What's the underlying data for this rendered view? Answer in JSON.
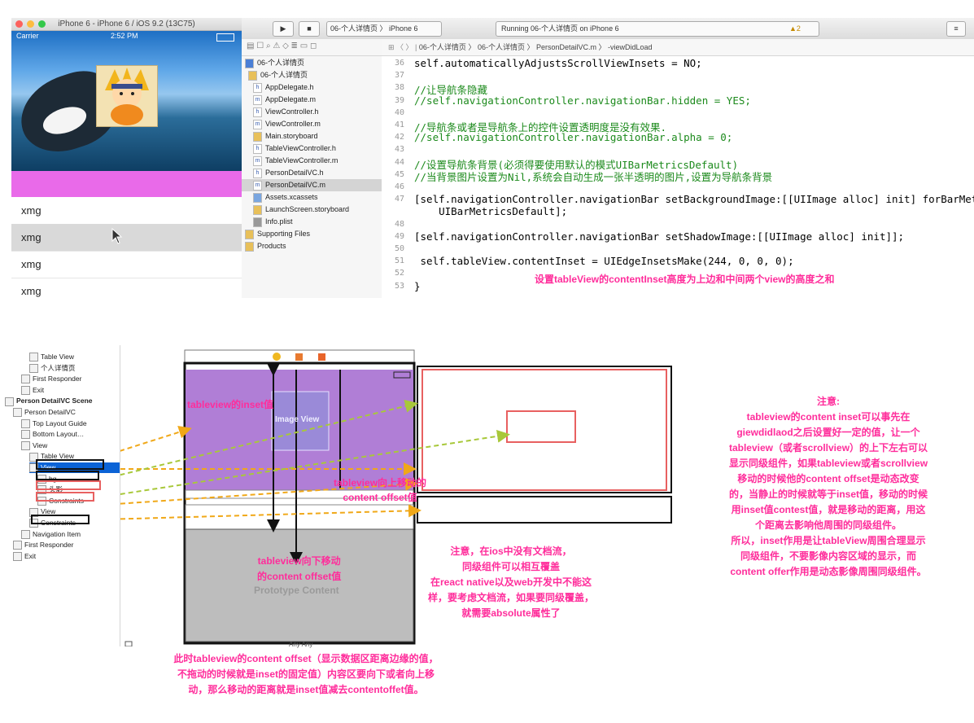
{
  "simulator": {
    "title": "iPhone 6 - iPhone 6 / iOS 9.2 (13C75)",
    "carrier": "Carrier",
    "time": "2:52 PM",
    "rows": [
      "xmg",
      "xmg",
      "xmg",
      "xmg"
    ],
    "pink_color": "#e96ae9"
  },
  "xcode": {
    "toolbar": {
      "scheme": "06-个人详情页",
      "device": "iPhone 6",
      "status": "Running 06-个人详情页 on iPhone 6",
      "warning_count": "2"
    },
    "jump_bar": [
      "06-个人详情页",
      "06-个人详情页",
      "PersonDetailVC.m",
      "-viewDidLoad"
    ],
    "files": [
      {
        "name": "06-个人详情页",
        "kind": "project"
      },
      {
        "name": "06-个人详情页",
        "kind": "folder"
      },
      {
        "name": "AppDelegate.h",
        "kind": "h"
      },
      {
        "name": "AppDelegate.m",
        "kind": "m"
      },
      {
        "name": "ViewController.h",
        "kind": "h"
      },
      {
        "name": "ViewController.m",
        "kind": "m"
      },
      {
        "name": "Main.storyboard",
        "kind": "sb"
      },
      {
        "name": "TableViewController.h",
        "kind": "h"
      },
      {
        "name": "TableViewController.m",
        "kind": "m"
      },
      {
        "name": "PersonDetailVC.h",
        "kind": "h"
      },
      {
        "name": "PersonDetailVC.m",
        "kind": "m",
        "selected": true
      },
      {
        "name": "Assets.xcassets",
        "kind": "asset"
      },
      {
        "name": "LaunchScreen.storyboard",
        "kind": "sb"
      },
      {
        "name": "Info.plist",
        "kind": "plist"
      },
      {
        "name": "Supporting Files",
        "kind": "folder"
      },
      {
        "name": "Products",
        "kind": "folder"
      }
    ],
    "code_lines": [
      {
        "n": "36",
        "text": "self.automaticallyAdjustsScrollViewInsets = NO;"
      },
      {
        "n": "37",
        "text": ""
      },
      {
        "n": "38",
        "text": "//让导航条隐藏"
      },
      {
        "n": "39",
        "text": "//self.navigationController.navigationBar.hidden = YES;"
      },
      {
        "n": "40",
        "text": ""
      },
      {
        "n": "41",
        "text": "//导航条或者是导航条上的控件设置透明度是没有效果."
      },
      {
        "n": "42",
        "text": "//self.navigationController.navigationBar.alpha = 0;"
      },
      {
        "n": "43",
        "text": ""
      },
      {
        "n": "44",
        "text": "//设置导航条背景(必须得要使用默认的模式UIBarMetricsDefault)"
      },
      {
        "n": "45",
        "text": "//当背景图片设置为Nil,系统会自动生成一张半透明的图片,设置为导航条背景"
      },
      {
        "n": "46",
        "text": ""
      },
      {
        "n": "47",
        "text": "[self.navigationController.navigationBar setBackgroundImage:[[UIImage alloc] init] forBarMetrics:"
      },
      {
        "n": "",
        "text": "    UIBarMetricsDefault];"
      },
      {
        "n": "48",
        "text": ""
      },
      {
        "n": "49",
        "text": "[self.navigationController.navigationBar setShadowImage:[[UIImage alloc] init]];"
      },
      {
        "n": "50",
        "text": ""
      },
      {
        "n": "51",
        "text": " self.tableView.contentInset = UIEdgeInsetsMake(244, 0, 0, 0);"
      },
      {
        "n": "52",
        "text": ""
      },
      {
        "n": "53",
        "text": "}"
      }
    ],
    "annotation": "设置tableView的contentInset高度为上边和中间两个view的高度之和"
  },
  "outline": {
    "items": [
      {
        "label": "Table View",
        "indent": 3
      },
      {
        "label": "个人详情页",
        "indent": 3
      },
      {
        "label": "First Responder",
        "indent": 2
      },
      {
        "label": "Exit",
        "indent": 2
      },
      {
        "label": "Person DetailVC Scene",
        "indent": 0,
        "bold": true
      },
      {
        "label": "Person DetailVC",
        "indent": 1
      },
      {
        "label": "Top Layout Guide",
        "indent": 2
      },
      {
        "label": "Bottom Layout…",
        "indent": 2
      },
      {
        "label": "View",
        "indent": 2
      },
      {
        "label": "Table View",
        "indent": 3
      },
      {
        "label": "View",
        "indent": 3,
        "selected": true
      },
      {
        "label": "bg",
        "indent": 4
      },
      {
        "label": "头影",
        "indent": 4
      },
      {
        "label": "Constraints",
        "indent": 4
      },
      {
        "label": "View",
        "indent": 3
      },
      {
        "label": "Constraints",
        "indent": 3
      },
      {
        "label": "Navigation Item",
        "indent": 2
      },
      {
        "label": "First Responder",
        "indent": 1
      },
      {
        "label": "Exit",
        "indent": 1
      }
    ]
  },
  "canvas": {
    "image_view_label": "Image View",
    "prototype_label": "Prototype Content",
    "size_label": "Any  Any",
    "labels": {
      "inset": "tableview的inset值",
      "move_up": "tableview向上移动的\ncontent offset值",
      "move_down": "tableview向下移动\n的content offset值"
    },
    "note_right_title": "注意:",
    "note_right": [
      "tableview的content inset可以事先在",
      "giewdidlaod之后设置好一定的值，让一个",
      "tableview（或者scrollview）的上下左右可以",
      "显示同级组件，如果tableview或者scrollview",
      "移动的时候他的content offset是动态改变",
      "的，当静止的时候就等于inset值，移动的时候",
      "用inset值contest值，就是移动的距离，用这",
      "个距离去影响他周围的同级组件。",
      "所以，inset作用是让tableView周围合理显示",
      "同级组件，不要影像内容区域的显示，而",
      "content offer作用是动态影像周围同级组件。"
    ],
    "note_mid": [
      "注意，在ios中没有文档流，",
      "同级组件可以相互覆盖",
      "在react native以及web开发中不能这",
      "样，要考虑文档流，如果要同级覆盖，",
      "就需要absolute属性了"
    ],
    "note_bottom": [
      "此时tableview的content offset（显示数据区距离边缘的值，",
      "不拖动的时候就是inset的固定值）内容区要向下或者向上移",
      "动，那么移动的距离就是inset值减去contentoffet值。"
    ]
  },
  "colors": {
    "annotation": "#ff2d9b",
    "selection": "#0b63d6",
    "purple_view": "#b07ed6",
    "arrow_orange": "#f0a818",
    "arrow_green": "#a8c83a"
  }
}
